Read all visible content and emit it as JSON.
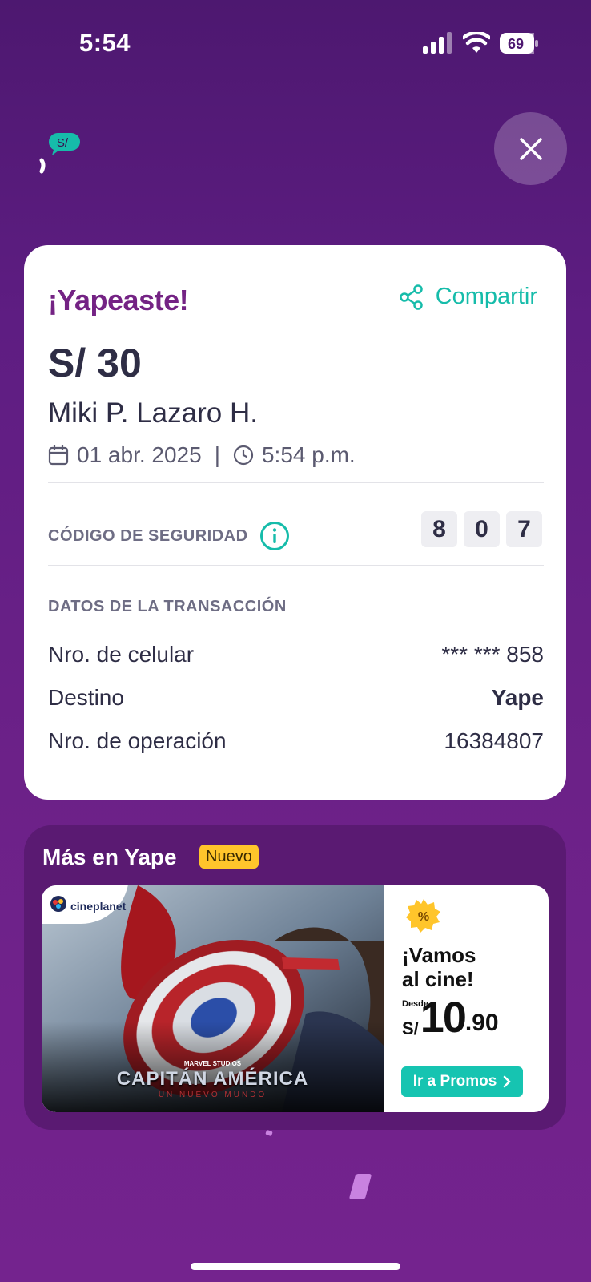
{
  "status_bar": {
    "time": "5:54",
    "battery": "69"
  },
  "header": {
    "logo_text": "S/"
  },
  "receipt": {
    "title": "¡Yapeaste!",
    "share_label": "Compartir",
    "amount": "S/ 30",
    "recipient": "Miki P. Lazaro H.",
    "date": "01 abr. 2025",
    "separator": "|",
    "time": "5:54 p.m.",
    "security_label": "CÓDIGO DE SEGURIDAD",
    "security_digits": [
      "8",
      "0",
      "7"
    ],
    "transaction_title": "DATOS DE LA TRANSACCIÓN",
    "rows": [
      {
        "label": "Nro. de celular",
        "value": "*** *** 858"
      },
      {
        "label": "Destino",
        "value": "Yape"
      },
      {
        "label": "Nro. de operación",
        "value": "16384807"
      }
    ]
  },
  "more": {
    "title": "Más en Yape",
    "badge": "Nuevo",
    "promo": {
      "brand": "cineplanet",
      "studio": "MARVEL STUDIOS",
      "movie_title": "CAPITÁN AMÉRICA",
      "movie_subtitle": "UN NUEVO MUNDO",
      "headline_line1": "¡Vamos",
      "headline_line2": "al cine!",
      "price_prefix": "Desde",
      "price_currency": "S/",
      "price_int": "10",
      "price_dec": ".90",
      "button_label": "Ir a Promos"
    }
  },
  "colors": {
    "accent": "#16bcaa",
    "brand": "#742384",
    "badge": "#ffc52b"
  }
}
